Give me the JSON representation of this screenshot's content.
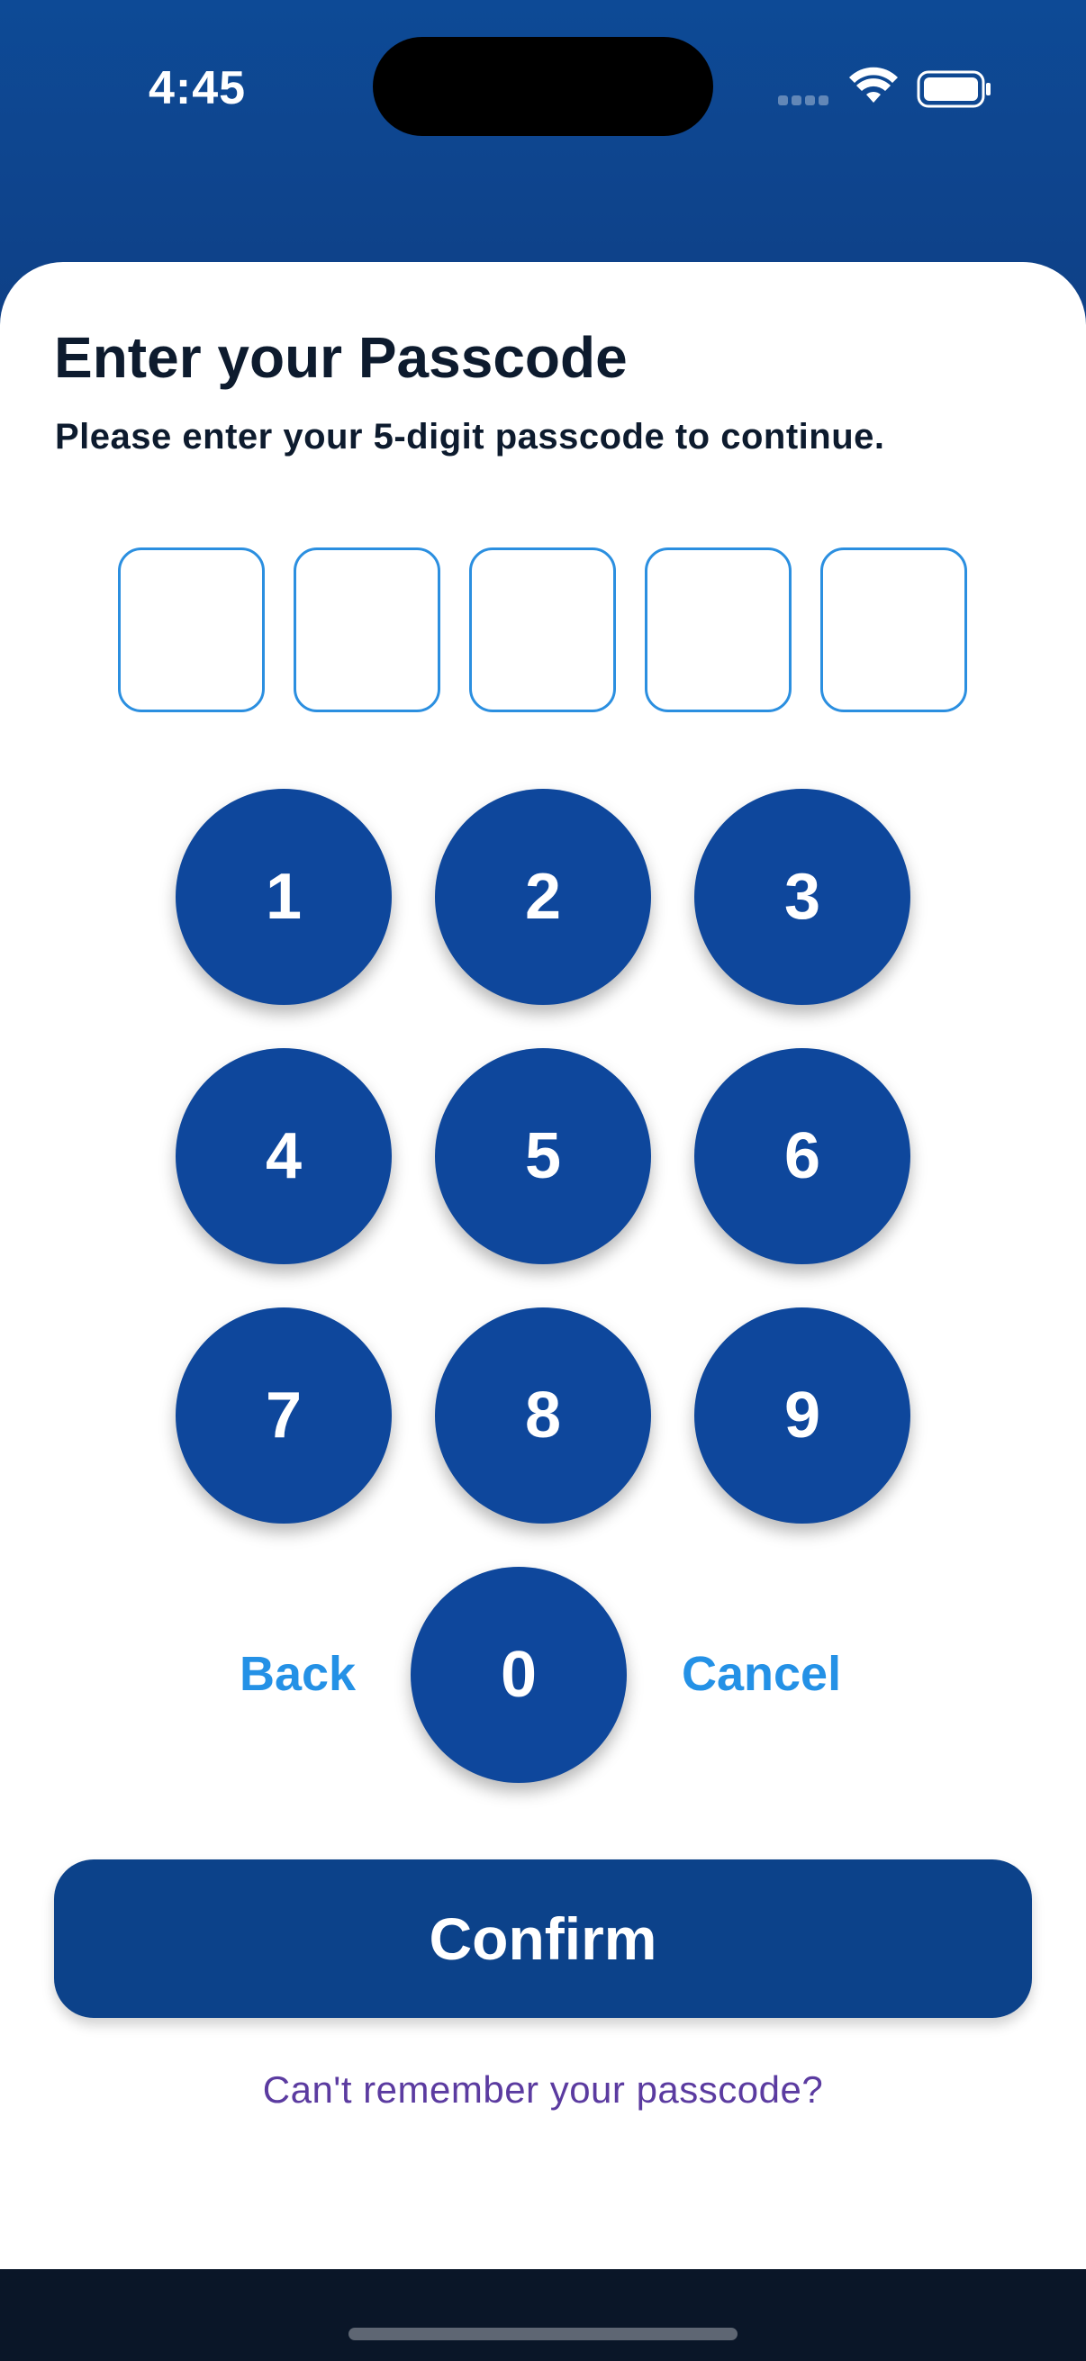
{
  "status_bar": {
    "time": "4:45"
  },
  "header": {
    "title": "Enter your Passcode",
    "subtitle": "Please enter your 5-digit passcode to continue."
  },
  "pin": {
    "digits": [
      "",
      "",
      "",
      "",
      ""
    ]
  },
  "keypad": {
    "keys": [
      "1",
      "2",
      "3",
      "4",
      "5",
      "6",
      "7",
      "8",
      "9",
      "0"
    ],
    "back_label": "Back",
    "cancel_label": "Cancel"
  },
  "actions": {
    "confirm_label": "Confirm",
    "forgot_label": "Can't remember your passcode?"
  },
  "colors": {
    "primary": "#0e479c",
    "accent": "#2491e6",
    "link": "#5b3ba0",
    "header_bg": "#0d4a96"
  },
  "icons": [
    "wifi-icon",
    "battery-icon",
    "cellular-signal-icon"
  ]
}
